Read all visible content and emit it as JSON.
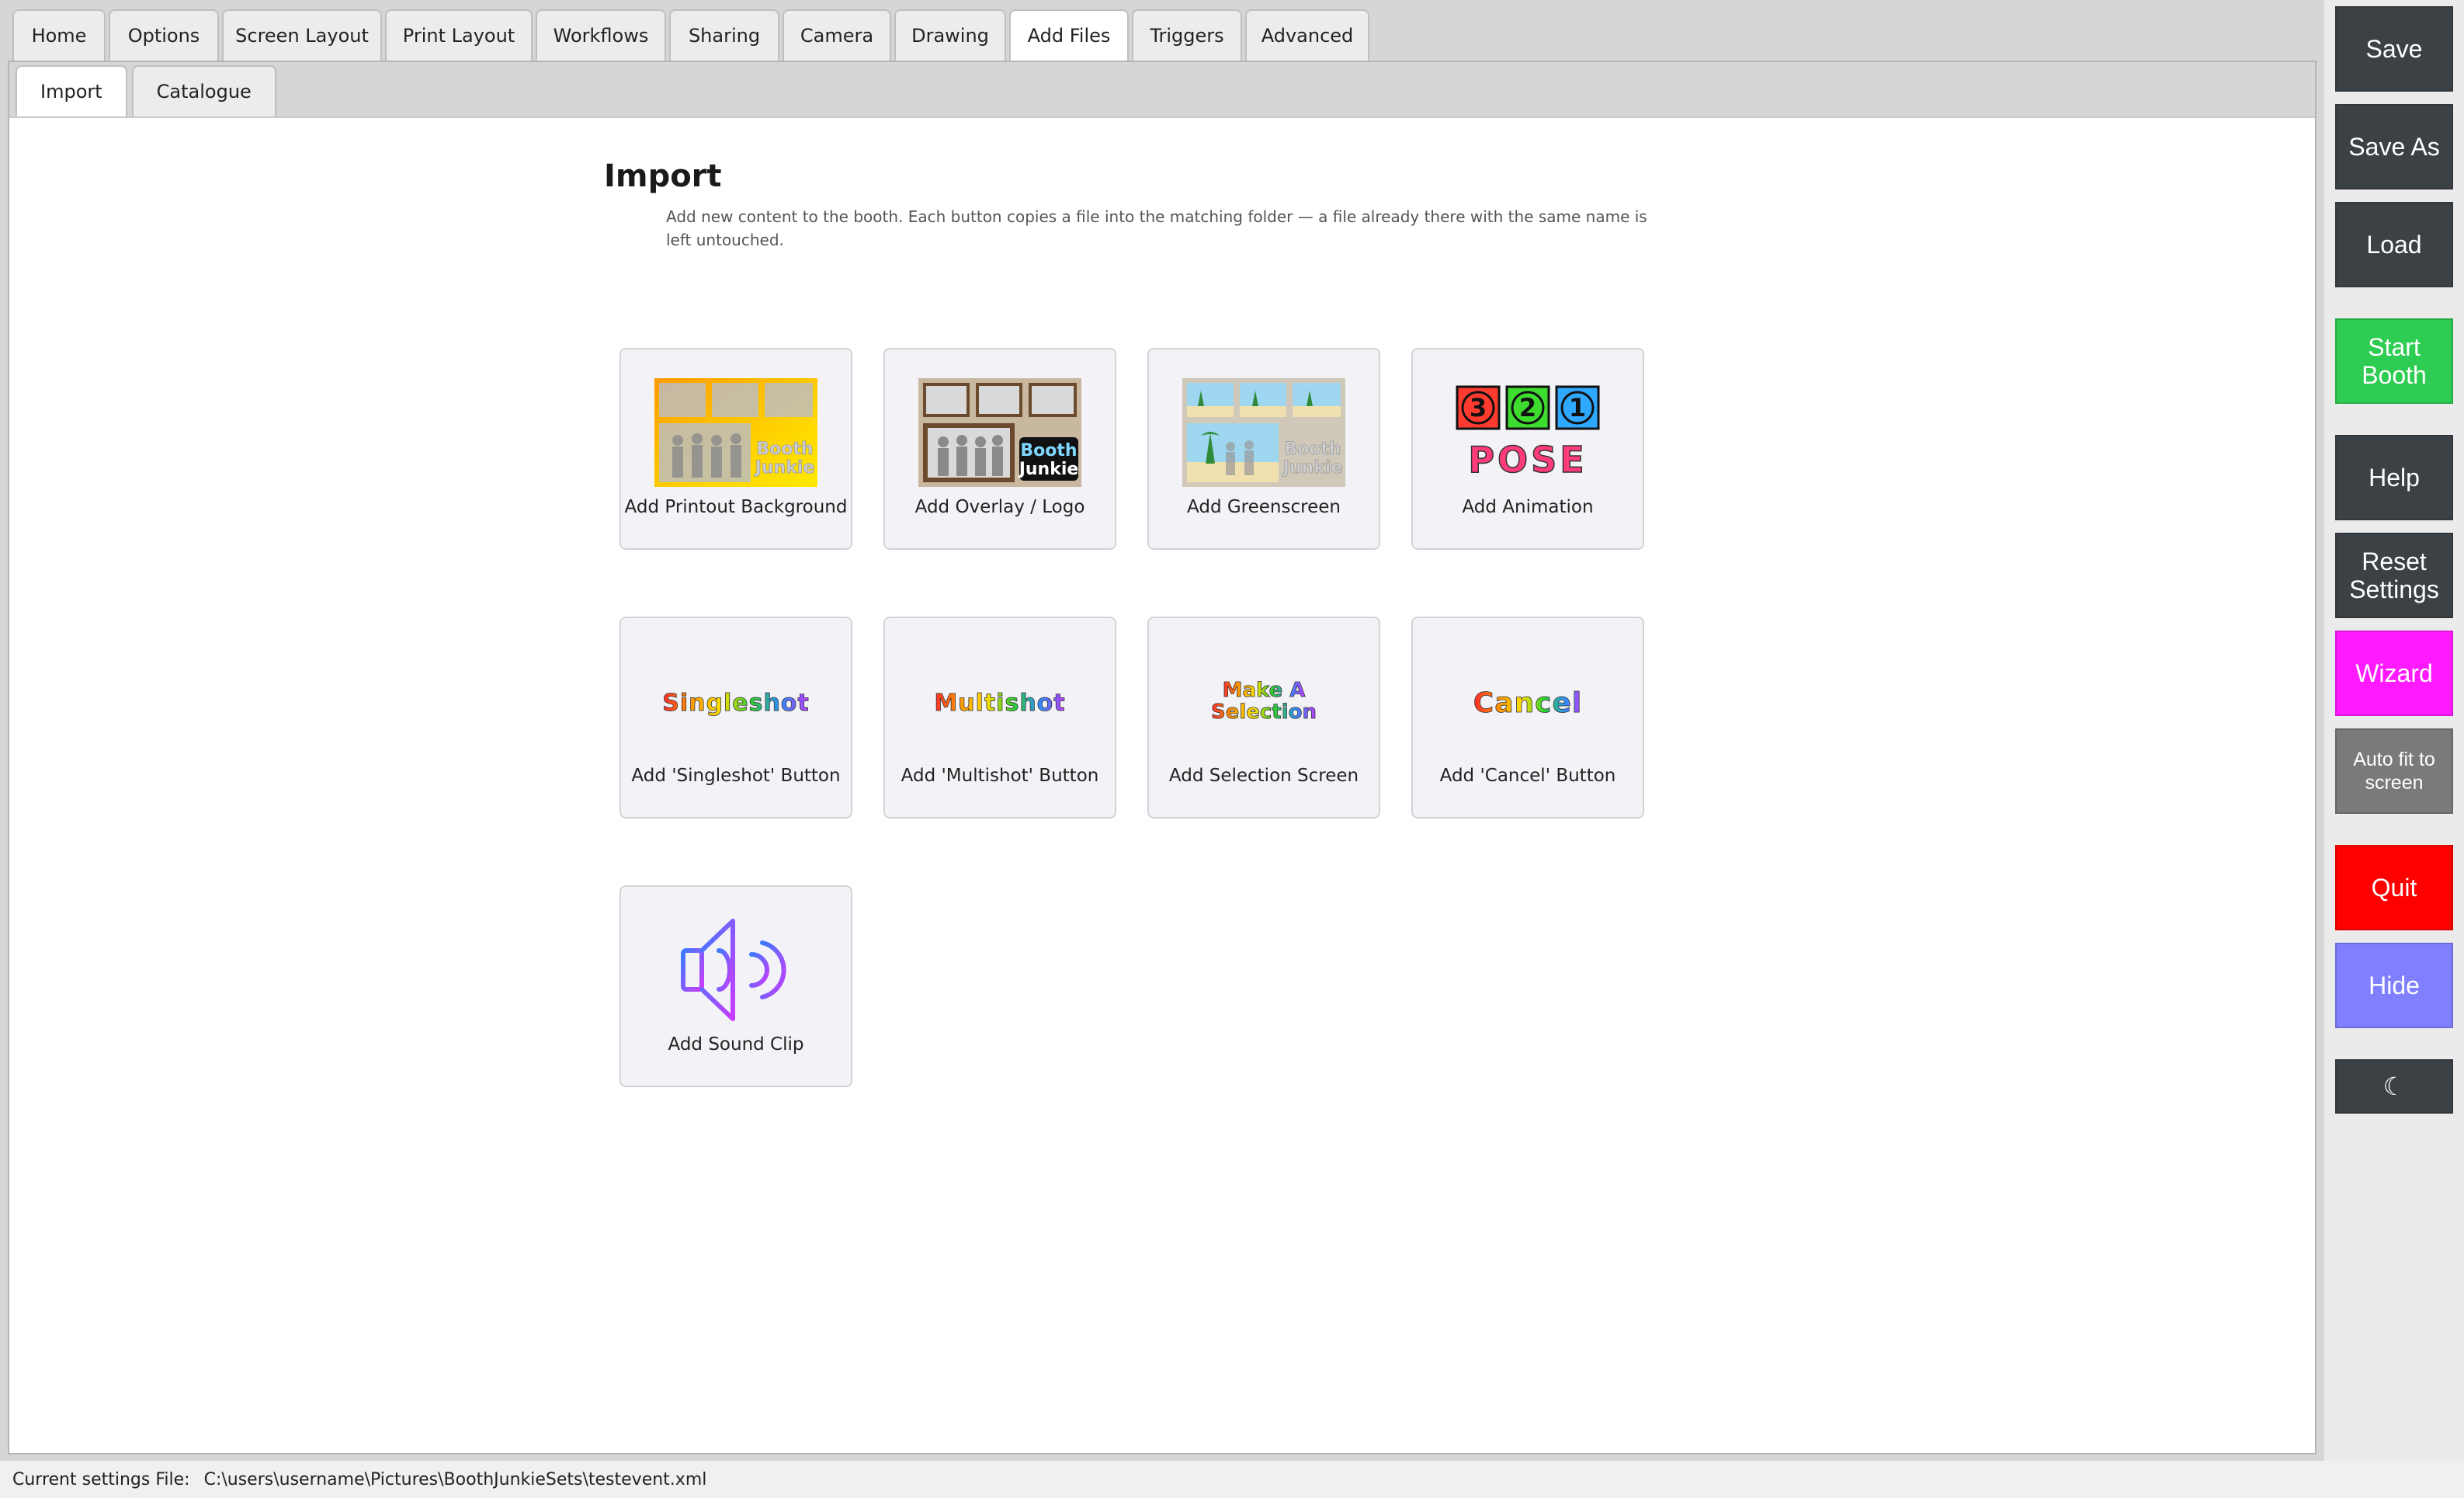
{
  "main_tabs": [
    {
      "label": "Home",
      "active": false
    },
    {
      "label": "Options",
      "active": false
    },
    {
      "label": "Screen Layout",
      "active": false
    },
    {
      "label": "Print Layout",
      "active": false
    },
    {
      "label": "Workflows",
      "active": false
    },
    {
      "label": "Sharing",
      "active": false
    },
    {
      "label": "Camera",
      "active": false
    },
    {
      "label": "Drawing",
      "active": false
    },
    {
      "label": "Add Files",
      "active": true
    },
    {
      "label": "Triggers",
      "active": false
    },
    {
      "label": "Advanced",
      "active": false
    }
  ],
  "sub_tabs": [
    {
      "label": "Import",
      "active": true
    },
    {
      "label": "Catalogue",
      "active": false
    }
  ],
  "section": {
    "title": "Import",
    "description": "Add new content to the booth. Each button copies a file into the matching folder — a file already there with the same name is left untouched."
  },
  "cards": [
    {
      "label": "Add Printout Background",
      "icon": "printout-background-thumbnail",
      "thumb_text": [
        "Booth",
        "Junkie"
      ]
    },
    {
      "label": "Add Overlay / Logo",
      "icon": "overlay-logo-thumbnail",
      "thumb_text": [
        "Booth",
        "Junkie"
      ]
    },
    {
      "label": "Add Greenscreen",
      "icon": "greenscreen-thumbnail",
      "thumb_text": [
        "Booth",
        "Junkie"
      ]
    },
    {
      "label": "Add Animation",
      "icon": "countdown-animation-thumbnail",
      "thumb_text": [
        "3",
        "2",
        "1",
        "POSE"
      ]
    },
    {
      "label": "Add 'Singleshot' Button",
      "icon": "singleshot-text-thumbnail",
      "thumb_text": "Singleshot"
    },
    {
      "label": "Add 'Multishot' Button",
      "icon": "multishot-text-thumbnail",
      "thumb_text": "Multishot"
    },
    {
      "label": "Add Selection Screen",
      "icon": "selection-text-thumbnail",
      "thumb_text": [
        "Make A",
        "Selection"
      ]
    },
    {
      "label": "Add 'Cancel' Button",
      "icon": "cancel-text-thumbnail",
      "thumb_text": "Cancel"
    },
    {
      "label": "Add Sound Clip",
      "icon": "speaker-icon"
    }
  ],
  "sidebar": {
    "buttons": [
      {
        "label": "Save",
        "color": "#3c4146"
      },
      {
        "label": "Save As",
        "color": "#3c4146"
      },
      {
        "label": "Load",
        "color": "#3c4146"
      },
      {
        "label": "Start Booth",
        "color": "#2ecc52"
      },
      {
        "label": "Help",
        "color": "#3c4146"
      },
      {
        "label": "Reset Settings",
        "color": "#3c4146"
      },
      {
        "label": "Wizard",
        "color": "#ff1aff"
      },
      {
        "label": "Auto fit to screen",
        "color": "#7a7a7a"
      },
      {
        "label": "Quit",
        "color": "#ff0000"
      },
      {
        "label": "Hide",
        "color": "#8080ff"
      },
      {
        "label": "☾",
        "color": "#3c4146",
        "icon": "moon-icon"
      }
    ]
  },
  "status": {
    "label": "Current settings File:",
    "path": "C:\\users\\username\\Pictures\\BoothJunkieSets\\testevent.xml"
  }
}
